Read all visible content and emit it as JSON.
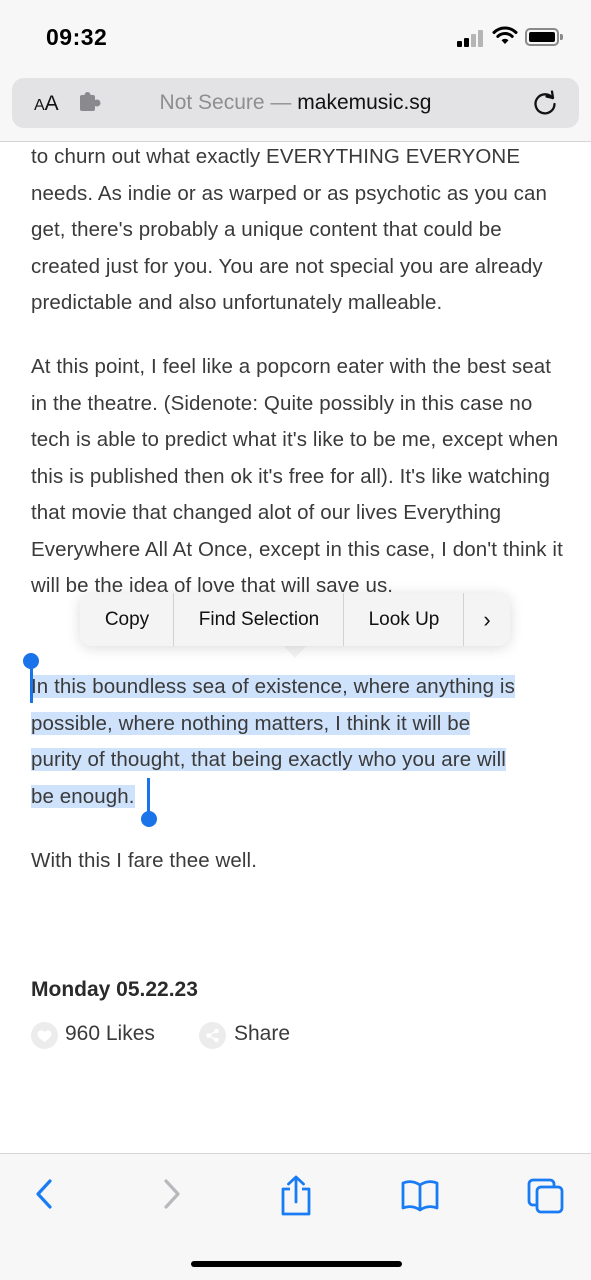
{
  "status": {
    "time": "09:32"
  },
  "browser": {
    "aa_small": "A",
    "aa_big": "A",
    "url_prefix": "Not Secure — ",
    "url_host": "makemusic.sg"
  },
  "article": {
    "p1": "to churn out what exactly EVERYTHING EVERYONE needs. As indie or as warped or as psychotic as you can get, there's probably a unique content that could be created just for you. You are not special you are already predictable and also unfortunately malleable.",
    "p2": "At this point, I feel like a popcorn eater with the best seat in the theatre. (Sidenote: Quite possibly in this case no tech is able to predict what it's like to be me, except when this is published then ok it's free for all). It's like watching that movie that changed alot of our lives Everything Everywhere All At Once, except in this case, I don't think it will be the idea of love that will save us.",
    "p3_lines": [
      "In this boundless sea of existence, where anything is",
      "possible, where nothing matters, I think it will be",
      "purity of thought, that being exactly who you are will",
      "be enough."
    ],
    "p4": "With this I fare thee well.",
    "date": "Monday 05.22.23",
    "likes": "960 Likes",
    "share": "Share"
  },
  "callout_menu": {
    "copy": "Copy",
    "find_selection": "Find Selection",
    "look_up": "Look Up",
    "more": "›"
  },
  "colors": {
    "selection": "#cfe2fb",
    "accent": "#1a73e8",
    "toolbar_icon": "#1a7cf5"
  },
  "toolbar_icons": [
    "back-icon",
    "forward-icon",
    "share-icon",
    "bookmarks-icon",
    "tabs-icon"
  ]
}
